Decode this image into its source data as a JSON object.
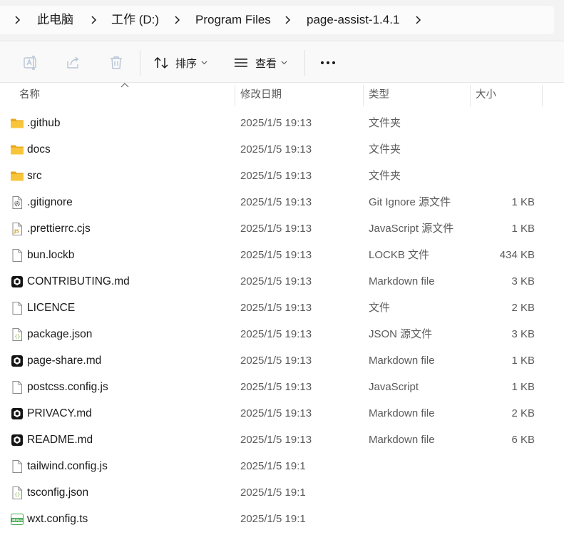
{
  "breadcrumb": {
    "items": [
      {
        "label": "此电脑"
      },
      {
        "label": "工作 (D:)"
      },
      {
        "label": "Program Files"
      },
      {
        "label": "page-assist-1.4.1"
      }
    ]
  },
  "toolbar": {
    "sort_label": "排序",
    "view_label": "查看",
    "more_label": "•••"
  },
  "columns": {
    "name": "名称",
    "modified": "修改日期",
    "type": "类型",
    "size": "大小"
  },
  "files": [
    {
      "icon": "folder-icon",
      "name": ".github",
      "modified": "2025/1/5 19:13",
      "type": "文件夹",
      "size": ""
    },
    {
      "icon": "folder-icon",
      "name": "docs",
      "modified": "2025/1/5 19:13",
      "type": "文件夹",
      "size": ""
    },
    {
      "icon": "folder-icon",
      "name": "src",
      "modified": "2025/1/5 19:13",
      "type": "文件夹",
      "size": ""
    },
    {
      "icon": "gear-file-icon",
      "name": ".gitignore",
      "modified": "2025/1/5 19:13",
      "type": "Git Ignore 源文件",
      "size": "1 KB"
    },
    {
      "icon": "js-file-icon",
      "name": ".prettierrc.cjs",
      "modified": "2025/1/5 19:13",
      "type": "JavaScript 源文件",
      "size": "1 KB"
    },
    {
      "icon": "blank-file-icon",
      "name": "bun.lockb",
      "modified": "2025/1/5 19:13",
      "type": "LOCKB 文件",
      "size": "434 KB"
    },
    {
      "icon": "markdown-app-icon",
      "name": "CONTRIBUTING.md",
      "modified": "2025/1/5 19:13",
      "type": "Markdown file",
      "size": "3 KB"
    },
    {
      "icon": "blank-file-icon",
      "name": "LICENCE",
      "modified": "2025/1/5 19:13",
      "type": "文件",
      "size": "2 KB"
    },
    {
      "icon": "json-file-icon",
      "name": "package.json",
      "modified": "2025/1/5 19:13",
      "type": "JSON 源文件",
      "size": "3 KB"
    },
    {
      "icon": "markdown-app-icon",
      "name": "page-share.md",
      "modified": "2025/1/5 19:13",
      "type": "Markdown file",
      "size": "1 KB"
    },
    {
      "icon": "blank-file-icon",
      "name": "postcss.config.js",
      "modified": "2025/1/5 19:13",
      "type": "JavaScript",
      "size": "1 KB"
    },
    {
      "icon": "markdown-app-icon",
      "name": "PRIVACY.md",
      "modified": "2025/1/5 19:13",
      "type": "Markdown file",
      "size": "2 KB"
    },
    {
      "icon": "markdown-app-icon",
      "name": "README.md",
      "modified": "2025/1/5 19:13",
      "type": "Markdown file",
      "size": "6 KB"
    },
    {
      "icon": "blank-file-icon",
      "name": "tailwind.config.js",
      "modified": "2025/1/5 19:1",
      "type": "",
      "size": ""
    },
    {
      "icon": "json-file-icon",
      "name": "tsconfig.json",
      "modified": "2025/1/5 19:1",
      "type": "",
      "size": ""
    },
    {
      "icon": "mpeg-file-icon",
      "name": "wxt.config.ts",
      "modified": "2025/1/5 19:1",
      "type": "",
      "size": ""
    }
  ],
  "colors": {
    "folder": "#f8c53a",
    "folder_dark": "#e9a81e",
    "text": "#1a1a1a",
    "secondary_text": "#5b5b5b",
    "toolbar_bg": "#f9f9f9",
    "address_bg": "#f3f3f3"
  }
}
